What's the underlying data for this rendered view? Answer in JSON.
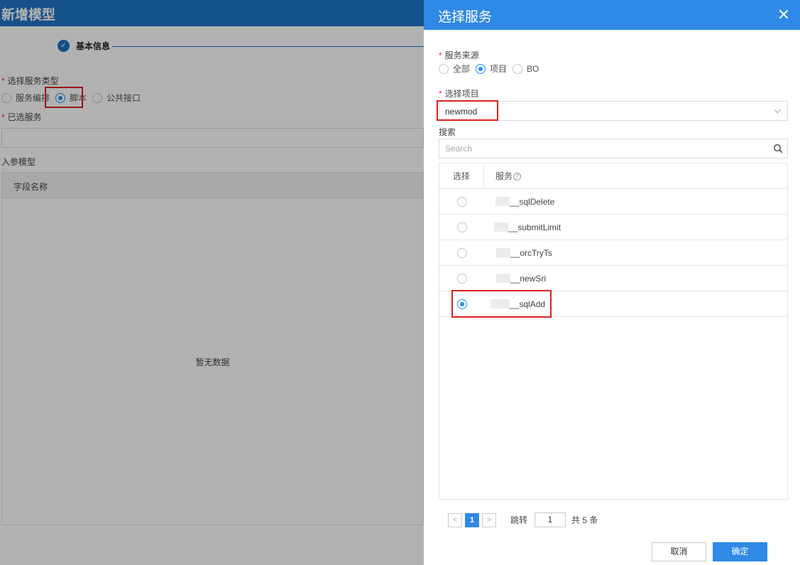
{
  "background": {
    "title": "新增模型",
    "step": {
      "icon": "check-icon",
      "label": "基本信息"
    },
    "service_type": {
      "label": "选择服务类型",
      "options": [
        "服务编排",
        "脚本",
        "公共接口"
      ],
      "selected_index": 1
    },
    "selected_service_label": "已选服务",
    "input_model_label": "入参模型",
    "table_header": "字段名称",
    "empty_text": "暂无数据"
  },
  "drawer": {
    "title": "选择服务",
    "source": {
      "label": "服务来源",
      "options": [
        "全部",
        "项目",
        "BO"
      ],
      "selected_index": 1
    },
    "project": {
      "label": "选择项目",
      "value": "newmod"
    },
    "search": {
      "label": "搜索",
      "placeholder": "Search"
    },
    "table": {
      "col_select": "选择",
      "col_service": "服务",
      "rows": [
        {
          "name": "__sqlDelete",
          "selected": false
        },
        {
          "name": "__submitLimit",
          "selected": false
        },
        {
          "name": "__orcTryTs",
          "selected": false
        },
        {
          "name": "__newSri",
          "selected": false
        },
        {
          "name": "__sqlAdd",
          "selected": true
        }
      ]
    },
    "pagination": {
      "prev": "<",
      "current": "1",
      "next": ">",
      "jump_label": "跳转",
      "jump_value": "1",
      "total": "共 5 条"
    },
    "buttons": {
      "cancel": "取消",
      "ok": "确定"
    }
  },
  "colors": {
    "accent": "#2f89e6",
    "highlight": "#e02020",
    "required": "#ee3333"
  }
}
